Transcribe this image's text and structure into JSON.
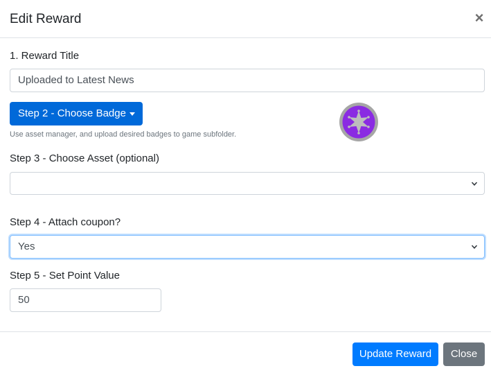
{
  "modal": {
    "title": "Edit Reward",
    "close_glyph": "×"
  },
  "form": {
    "title_label": "1. Reward Title",
    "title_value": "Uploaded to Latest News",
    "badge_button_label": "Step 2 - Choose Badge",
    "badge_hint": "Use asset manager, and upload desired badges to game subfolder.",
    "badge_icon": "sheriff-star-badge",
    "badge_color": "#8a2be2",
    "asset_label": "Step 3 - Choose Asset (optional)",
    "asset_value": "",
    "coupon_label": "Step 4 - Attach coupon?",
    "coupon_value": "Yes",
    "points_label": "Step 5 - Set Point Value",
    "points_value": "50"
  },
  "footer": {
    "update_label": "Update Reward",
    "close_label": "Close"
  },
  "colors": {
    "primary": "#007bff",
    "secondary": "#6c757d",
    "focus_border": "#80bdff"
  }
}
